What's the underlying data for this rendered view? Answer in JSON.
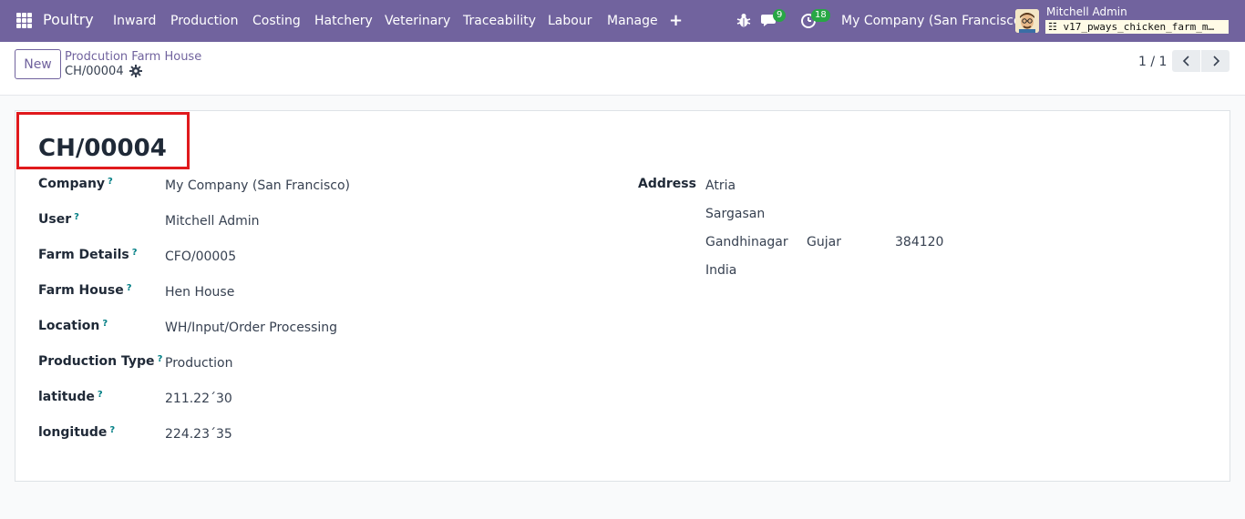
{
  "navbar": {
    "brand": "Poultry",
    "menu": [
      {
        "label": "Inward"
      },
      {
        "label": "Production"
      },
      {
        "label": "Costing"
      },
      {
        "label": "Hatchery"
      },
      {
        "label": "Veterinary"
      },
      {
        "label": "Traceability"
      },
      {
        "label": "Labour"
      },
      {
        "label": "Manage"
      }
    ],
    "plus": "+",
    "messages_count": "9",
    "activities_count": "18",
    "company": "My Company (San Francisco)",
    "user_name": "Mitchell Admin",
    "database": "v17_pways_chicken_farm_m…",
    "accent_color": "#71639e",
    "badge_color": "#28a745"
  },
  "control_panel": {
    "new_label": "New",
    "breadcrumb_parent": "Prodcution Farm House",
    "breadcrumb_current": "CH/00004",
    "pager": "1 / 1"
  },
  "form": {
    "name": "CH/00004",
    "help_mark": "?",
    "fields": [
      {
        "label": "Company",
        "value": "My Company (San Francisco)"
      },
      {
        "label": "User",
        "value": "Mitchell Admin"
      },
      {
        "label": "Farm Details",
        "value": "CFO/00005"
      },
      {
        "label": "Farm House",
        "value": "Hen House"
      },
      {
        "label": "Location",
        "value": "WH/Input/Order Processing"
      },
      {
        "label": "Production Type",
        "value": "Production"
      },
      {
        "label": "latitude",
        "value": "211.22´30"
      },
      {
        "label": "longitude",
        "value": "224.23´35"
      }
    ],
    "address": {
      "label": "Address",
      "street": "Atria",
      "street2": "Sargasan",
      "city": "Gandhinagar",
      "state": "Gujarat",
      "zip": "384120",
      "country": "India"
    },
    "highlight_color": "#e0191c"
  }
}
